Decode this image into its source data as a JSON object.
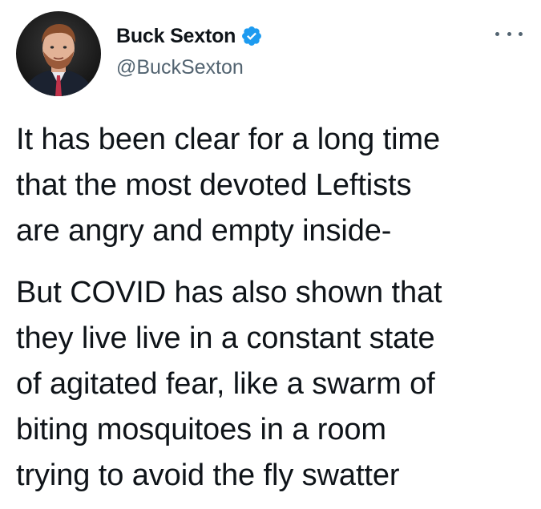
{
  "tweet": {
    "author": {
      "display_name": "Buck Sexton",
      "handle": "@BuckSexton",
      "verified": true,
      "avatar_icon": "profile-photo"
    },
    "more_icon": "ellipsis-icon",
    "paragraphs": [
      {
        "lines": [
          "It has been clear for a long time",
          "that the most devoted Leftists",
          "are angry and empty inside-"
        ]
      },
      {
        "lines": [
          "But COVID has also shown that",
          "they live live in a constant state",
          "of agitated fear, like a swarm of",
          "biting mosquitoes in a room",
          "trying to avoid the fly swatter"
        ]
      }
    ],
    "colors": {
      "verified_badge": "#1d9bf0",
      "text_primary": "#0f1419",
      "text_secondary": "#536471"
    }
  }
}
